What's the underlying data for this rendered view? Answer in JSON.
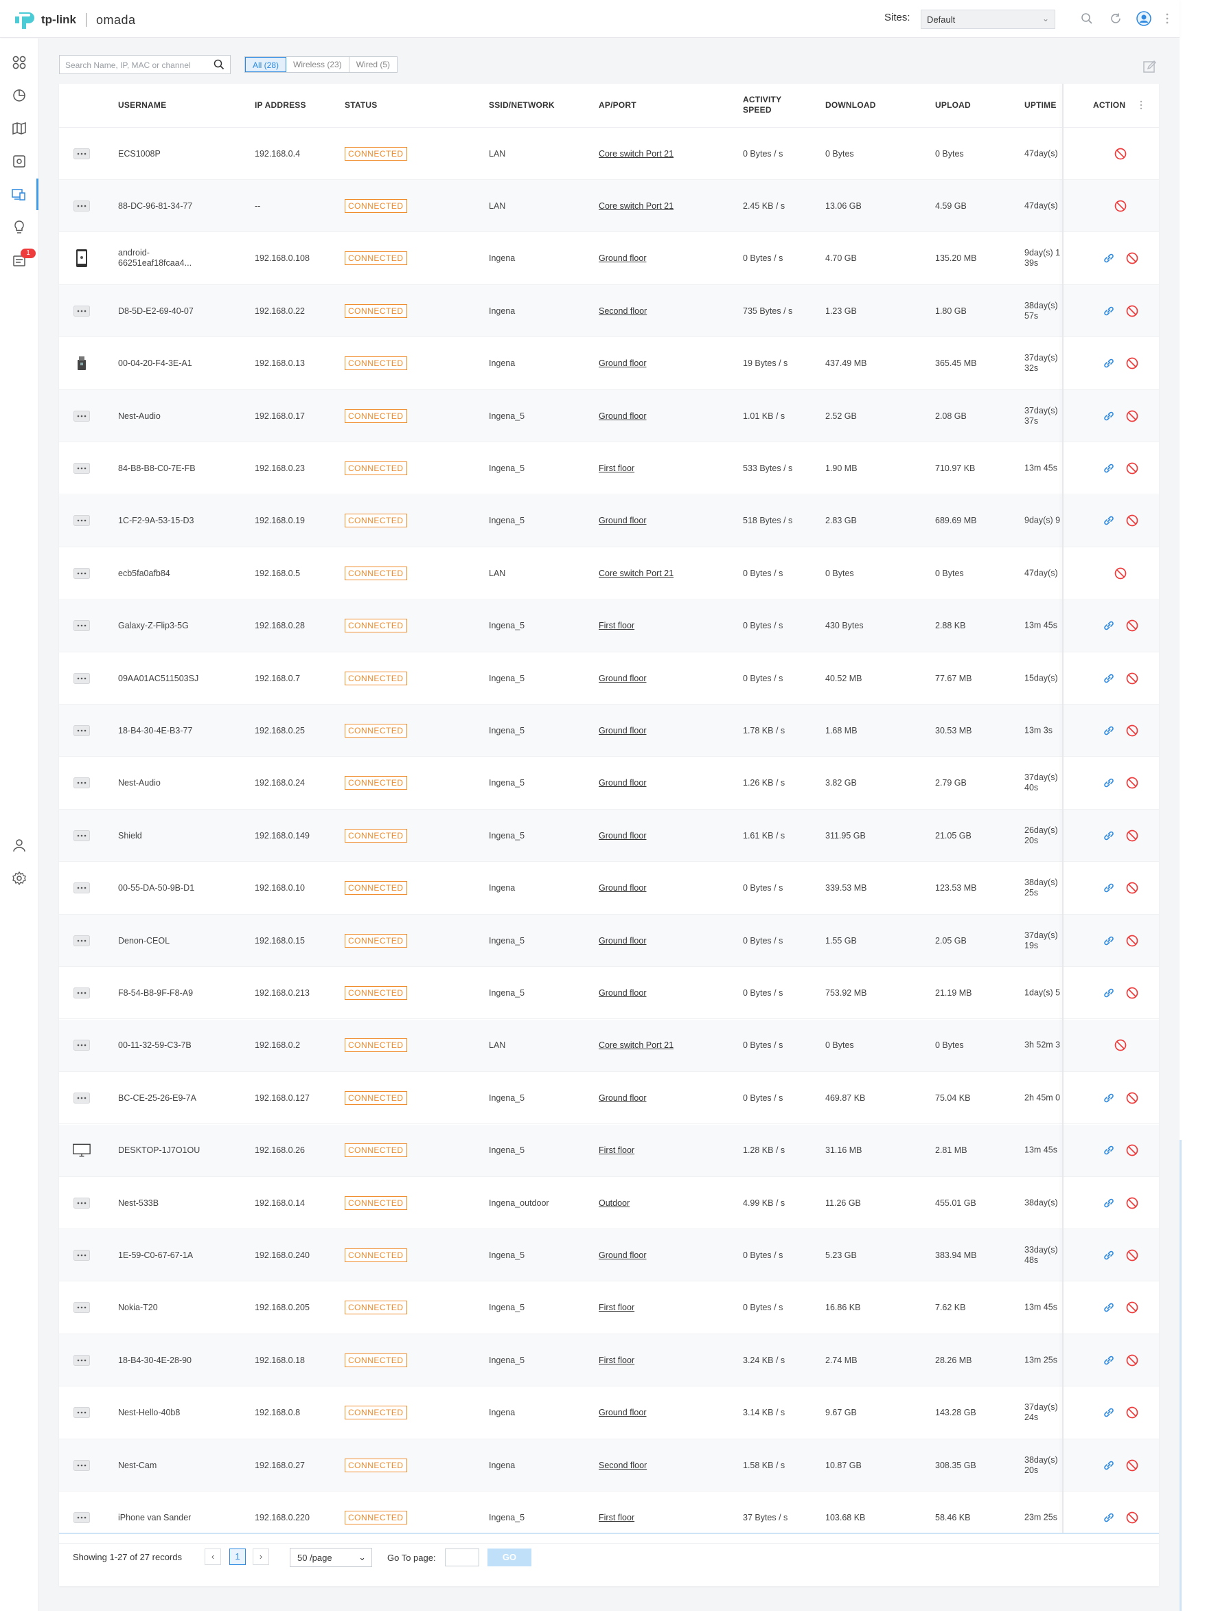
{
  "header": {
    "brand": "tp-link",
    "product": "omada",
    "sites_label": "Sites:",
    "site_value": "Default"
  },
  "sidebar": {
    "items": [
      {
        "name": "dashboard-icon"
      },
      {
        "name": "statistics-icon"
      },
      {
        "name": "map-icon"
      },
      {
        "name": "devices-icon"
      },
      {
        "name": "clients-icon",
        "active": true
      },
      {
        "name": "insight-icon"
      },
      {
        "name": "logs-icon",
        "badge": "1"
      },
      {
        "name": "admin-icon"
      },
      {
        "name": "settings-icon"
      }
    ]
  },
  "toolbar": {
    "search_placeholder": "Search Name, IP, MAC or channel",
    "filters": [
      "All (28)",
      "Wireless (23)",
      "Wired (5)"
    ]
  },
  "columns": {
    "username": "USERNAME",
    "ip": "IP ADDRESS",
    "status": "STATUS",
    "ssid": "SSID/NETWORK",
    "ap": "AP/PORT",
    "activity_1": "ACTIVITY",
    "activity_2": "SPEED",
    "download": "DOWNLOAD",
    "upload": "UPLOAD",
    "uptime": "UPTIME",
    "action": "ACTION"
  },
  "rows": [
    {
      "icon": "generic",
      "name": "ECS1008P",
      "ip": "192.168.0.4",
      "status": "CONNECTED",
      "ssid": "LAN",
      "ap": "Core switch Port 21",
      "speed": "0 Bytes / s",
      "down": "0 Bytes",
      "up": "0 Bytes",
      "uptime": [
        "47day(s)"
      ],
      "wired": true
    },
    {
      "icon": "generic",
      "name": "88-DC-96-81-34-77",
      "ip": "--",
      "status": "CONNECTED",
      "ssid": "LAN",
      "ap": "Core switch Port 21",
      "speed": "2.45 KB / s",
      "down": "13.06 GB",
      "up": "4.59 GB",
      "uptime": [
        "47day(s)"
      ],
      "wired": true
    },
    {
      "icon": "phone",
      "name": [
        "android-",
        "66251eaf18fcaa4..."
      ],
      "ip": "192.168.0.108",
      "status": "CONNECTED",
      "ssid": "Ingena",
      "ap": "Ground floor",
      "speed": "0 Bytes / s",
      "down": "4.70 GB",
      "up": "135.20 MB",
      "uptime": [
        "9day(s) 1",
        "39s"
      ],
      "wired": false
    },
    {
      "icon": "generic",
      "name": "D8-5D-E2-69-40-07",
      "ip": "192.168.0.22",
      "status": "CONNECTED",
      "ssid": "Ingena",
      "ap": "Second floor",
      "speed": "735 Bytes / s",
      "down": "1.23 GB",
      "up": "1.80 GB",
      "uptime": [
        "38day(s)",
        "57s"
      ],
      "wired": false
    },
    {
      "icon": "usb",
      "name": "00-04-20-F4-3E-A1",
      "ip": "192.168.0.13",
      "status": "CONNECTED",
      "ssid": "Ingena",
      "ap": "Ground floor",
      "speed": "19 Bytes / s",
      "down": "437.49 MB",
      "up": "365.45 MB",
      "uptime": [
        "37day(s)",
        "32s"
      ],
      "wired": false
    },
    {
      "icon": "generic",
      "name": "Nest-Audio",
      "ip": "192.168.0.17",
      "status": "CONNECTED",
      "ssid": "Ingena_5",
      "ap": "Ground floor",
      "speed": "1.01 KB / s",
      "down": "2.52 GB",
      "up": "2.08 GB",
      "uptime": [
        "37day(s)",
        "37s"
      ],
      "wired": false
    },
    {
      "icon": "generic",
      "name": "84-B8-B8-C0-7E-FB",
      "ip": "192.168.0.23",
      "status": "CONNECTED",
      "ssid": "Ingena_5",
      "ap": "First floor",
      "speed": "533 Bytes / s",
      "down": "1.90 MB",
      "up": "710.97 KB",
      "uptime": [
        "13m 45s"
      ],
      "wired": false
    },
    {
      "icon": "generic",
      "name": "1C-F2-9A-53-15-D3",
      "ip": "192.168.0.19",
      "status": "CONNECTED",
      "ssid": "Ingena_5",
      "ap": "Ground floor",
      "speed": "518 Bytes / s",
      "down": "2.83 GB",
      "up": "689.69 MB",
      "uptime": [
        "9day(s) 9"
      ],
      "wired": false
    },
    {
      "icon": "generic",
      "name": "ecb5fa0afb84",
      "ip": "192.168.0.5",
      "status": "CONNECTED",
      "ssid": "LAN",
      "ap": "Core switch Port 21",
      "speed": "0 Bytes / s",
      "down": "0 Bytes",
      "up": "0 Bytes",
      "uptime": [
        "47day(s)"
      ],
      "wired": true
    },
    {
      "icon": "generic",
      "name": "Galaxy-Z-Flip3-5G",
      "ip": "192.168.0.28",
      "status": "CONNECTED",
      "ssid": "Ingena_5",
      "ap": "First floor",
      "speed": "0 Bytes / s",
      "down": "430 Bytes",
      "up": "2.88 KB",
      "uptime": [
        "13m 45s"
      ],
      "wired": false
    },
    {
      "icon": "generic",
      "name": "09AA01AC511503SJ",
      "ip": "192.168.0.7",
      "status": "CONNECTED",
      "ssid": "Ingena_5",
      "ap": "Ground floor",
      "speed": "0 Bytes / s",
      "down": "40.52 MB",
      "up": "77.67 MB",
      "uptime": [
        "15day(s)"
      ],
      "wired": false
    },
    {
      "icon": "generic",
      "name": "18-B4-30-4E-B3-77",
      "ip": "192.168.0.25",
      "status": "CONNECTED",
      "ssid": "Ingena_5",
      "ap": "Ground floor",
      "speed": "1.78 KB / s",
      "down": "1.68 MB",
      "up": "30.53 MB",
      "uptime": [
        "13m 3s"
      ],
      "wired": false
    },
    {
      "icon": "generic",
      "name": "Nest-Audio",
      "ip": "192.168.0.24",
      "status": "CONNECTED",
      "ssid": "Ingena_5",
      "ap": "Ground floor",
      "speed": "1.26 KB / s",
      "down": "3.82 GB",
      "up": "2.79 GB",
      "uptime": [
        "37day(s)",
        "40s"
      ],
      "wired": false
    },
    {
      "icon": "generic",
      "name": "Shield",
      "ip": "192.168.0.149",
      "status": "CONNECTED",
      "ssid": "Ingena_5",
      "ap": "Ground floor",
      "speed": "1.61 KB / s",
      "down": "311.95 GB",
      "up": "21.05 GB",
      "uptime": [
        "26day(s)",
        "20s"
      ],
      "wired": false
    },
    {
      "icon": "generic",
      "name": "00-55-DA-50-9B-D1",
      "ip": "192.168.0.10",
      "status": "CONNECTED",
      "ssid": "Ingena",
      "ap": "Ground floor",
      "speed": "0 Bytes / s",
      "down": "339.53 MB",
      "up": "123.53 MB",
      "uptime": [
        "38day(s)",
        "25s"
      ],
      "wired": false
    },
    {
      "icon": "generic",
      "name": "Denon-CEOL",
      "ip": "192.168.0.15",
      "status": "CONNECTED",
      "ssid": "Ingena_5",
      "ap": "Ground floor",
      "speed": "0 Bytes / s",
      "down": "1.55 GB",
      "up": "2.05 GB",
      "uptime": [
        "37day(s)",
        "19s"
      ],
      "wired": false
    },
    {
      "icon": "generic",
      "name": "F8-54-B8-9F-F8-A9",
      "ip": "192.168.0.213",
      "status": "CONNECTED",
      "ssid": "Ingena_5",
      "ap": "Ground floor",
      "speed": "0 Bytes / s",
      "down": "753.92 MB",
      "up": "21.19 MB",
      "uptime": [
        "1day(s) 5"
      ],
      "wired": false
    },
    {
      "icon": "generic",
      "name": "00-11-32-59-C3-7B",
      "ip": "192.168.0.2",
      "status": "CONNECTED",
      "ssid": "LAN",
      "ap": "Core switch Port 21",
      "speed": "0 Bytes / s",
      "down": "0 Bytes",
      "up": "0 Bytes",
      "uptime": [
        "3h 52m 3"
      ],
      "wired": true
    },
    {
      "icon": "generic",
      "name": "BC-CE-25-26-E9-7A",
      "ip": "192.168.0.127",
      "status": "CONNECTED",
      "ssid": "Ingena_5",
      "ap": "Ground floor",
      "speed": "0 Bytes / s",
      "down": "469.87 KB",
      "up": "75.04 KB",
      "uptime": [
        "2h 45m 0"
      ],
      "wired": false
    },
    {
      "icon": "monitor",
      "name": "DESKTOP-1J7O1OU",
      "ip": "192.168.0.26",
      "status": "CONNECTED",
      "ssid": "Ingena_5",
      "ap": "First floor",
      "speed": "1.28 KB / s",
      "down": "31.16 MB",
      "up": "2.81 MB",
      "uptime": [
        "13m 45s"
      ],
      "wired": false
    },
    {
      "icon": "generic",
      "name": "Nest-533B",
      "ip": "192.168.0.14",
      "status": "CONNECTED",
      "ssid": "Ingena_outdoor",
      "ap": "Outdoor",
      "speed": "4.99 KB / s",
      "down": "11.26 GB",
      "up": "455.01 GB",
      "uptime": [
        "38day(s)"
      ],
      "wired": false
    },
    {
      "icon": "generic",
      "name": "1E-59-C0-67-67-1A",
      "ip": "192.168.0.240",
      "status": "CONNECTED",
      "ssid": "Ingena_5",
      "ap": "Ground floor",
      "speed": "0 Bytes / s",
      "down": "5.23 GB",
      "up": "383.94 MB",
      "uptime": [
        "33day(s)",
        "48s"
      ],
      "wired": false
    },
    {
      "icon": "generic",
      "name": "Nokia-T20",
      "ip": "192.168.0.205",
      "status": "CONNECTED",
      "ssid": "Ingena_5",
      "ap": "First floor",
      "speed": "0 Bytes / s",
      "down": "16.86 KB",
      "up": "7.62 KB",
      "uptime": [
        "13m 45s"
      ],
      "wired": false
    },
    {
      "icon": "generic",
      "name": "18-B4-30-4E-28-90",
      "ip": "192.168.0.18",
      "status": "CONNECTED",
      "ssid": "Ingena_5",
      "ap": "First floor",
      "speed": "3.24 KB / s",
      "down": "2.74 MB",
      "up": "28.26 MB",
      "uptime": [
        "13m 25s"
      ],
      "wired": false
    },
    {
      "icon": "generic",
      "name": "Nest-Hello-40b8",
      "ip": "192.168.0.8",
      "status": "CONNECTED",
      "ssid": "Ingena",
      "ap": "Ground floor",
      "speed": "3.14 KB / s",
      "down": "9.67 GB",
      "up": "143.28 GB",
      "uptime": [
        "37day(s)",
        "24s"
      ],
      "wired": false
    },
    {
      "icon": "generic",
      "name": "Nest-Cam",
      "ip": "192.168.0.27",
      "status": "CONNECTED",
      "ssid": "Ingena",
      "ap": "Second floor",
      "speed": "1.58 KB / s",
      "down": "10.87 GB",
      "up": "308.35 GB",
      "uptime": [
        "38day(s)",
        "20s"
      ],
      "wired": false
    },
    {
      "icon": "generic",
      "name": "iPhone van Sander",
      "ip": "192.168.0.220",
      "status": "CONNECTED",
      "ssid": "Ingena_5",
      "ap": "First floor",
      "speed": "37 Bytes / s",
      "down": "103.68 KB",
      "up": "58.46 KB",
      "uptime": [
        "23m 25s"
      ],
      "wired": false
    }
  ],
  "footer": {
    "showing": "Showing 1-27 of 27 records",
    "prev": "‹",
    "page": "1",
    "next": "›",
    "per_page": "50 /page",
    "goto_label": "Go To page:",
    "go": "GO"
  },
  "colors": {
    "accent": "#2d8ae0",
    "status": "#f08c2c",
    "block": "#ee3b3b"
  }
}
